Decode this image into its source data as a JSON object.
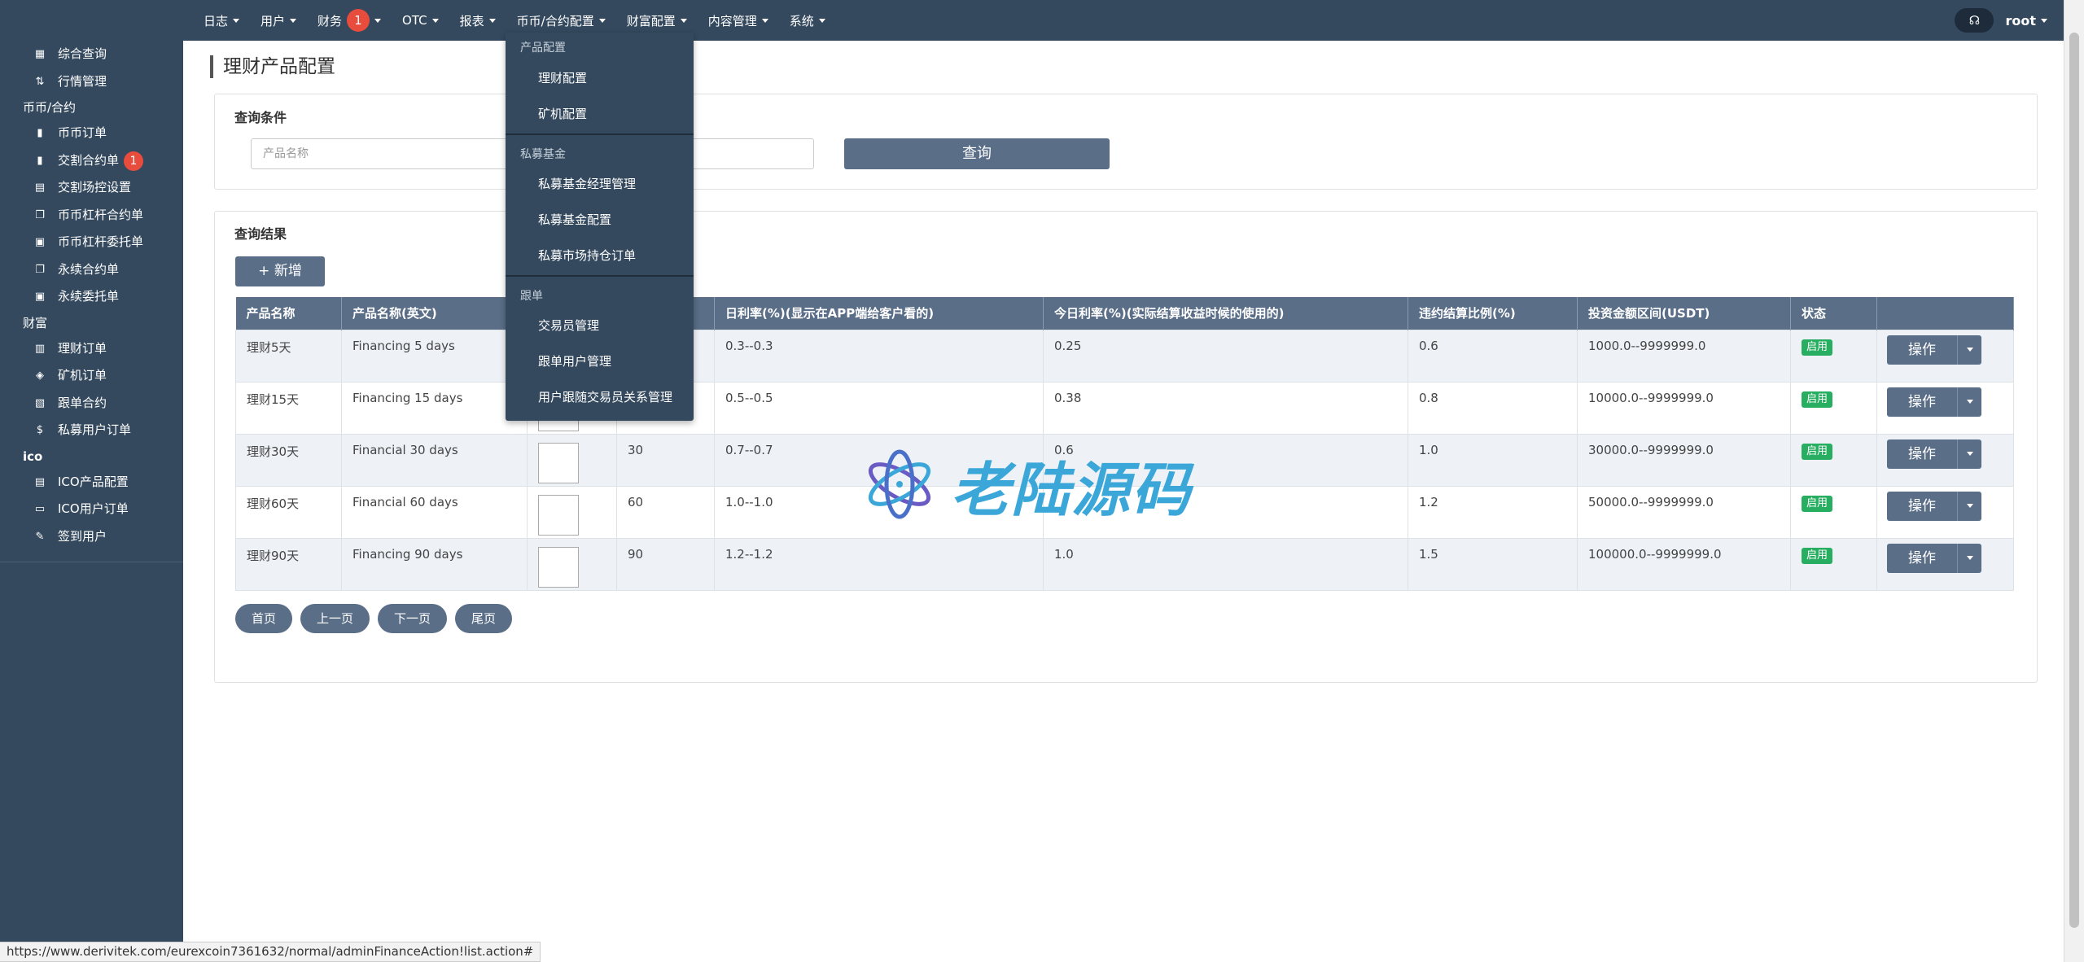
{
  "topnav": {
    "items": [
      {
        "label": "日志"
      },
      {
        "label": "用户"
      },
      {
        "label": "财务",
        "badge": "1"
      },
      {
        "label": "OTC"
      },
      {
        "label": "报表"
      },
      {
        "label": "币币/合约配置"
      },
      {
        "label": "财富配置"
      },
      {
        "label": "内容管理"
      },
      {
        "label": "系统"
      }
    ],
    "user": "root"
  },
  "sidebar": {
    "sections": [
      {
        "header": "",
        "items": [
          {
            "label": "综合查询",
            "icon": "dashboard-icon"
          },
          {
            "label": "行情管理",
            "icon": "sort-icon"
          }
        ]
      },
      {
        "header": "币币/合约",
        "items": [
          {
            "label": "币币订单",
            "icon": "bookmark-icon"
          },
          {
            "label": "交割合约单",
            "icon": "bookmark-icon",
            "badge": "1"
          },
          {
            "label": "交割场控设置",
            "icon": "clipboard-icon"
          },
          {
            "label": "币币杠杆合约单",
            "icon": "copy-icon"
          },
          {
            "label": "币币杠杆委托单",
            "icon": "file-clock-icon"
          },
          {
            "label": "永续合约单",
            "icon": "copy-icon"
          },
          {
            "label": "永续委托单",
            "icon": "file-clock-icon"
          }
        ]
      },
      {
        "header": "财富",
        "items": [
          {
            "label": "理财订单",
            "icon": "wallet-icon"
          },
          {
            "label": "矿机订单",
            "icon": "layers-icon"
          },
          {
            "label": "跟单合约",
            "icon": "file-user-icon"
          },
          {
            "label": "私募用户订单",
            "icon": "dollar-icon"
          }
        ]
      },
      {
        "header": "ico",
        "items": [
          {
            "label": "ICO产品配置",
            "icon": "file-list-icon"
          },
          {
            "label": "ICO用户订单",
            "icon": "screen-icon"
          },
          {
            "label": "签到用户",
            "icon": "edit-icon"
          }
        ]
      }
    ]
  },
  "page": {
    "title": "理财产品配置"
  },
  "query": {
    "title": "查询条件",
    "placeholder": "产品名称",
    "button": "查询"
  },
  "results": {
    "title": "查询结果",
    "add_button": "+ 新增",
    "columns": [
      "产品名称",
      "产品名称(英文)",
      "",
      "",
      "日利率(%)(显示在APP端给客户看的)",
      "今日利率(%)(实际结算收益时候的使用的)",
      "违约结算比例(%)",
      "投资金额区间(USDT)",
      "状态",
      ""
    ],
    "rows": [
      {
        "name": "理财5天",
        "name_en": "Financing 5 days",
        "days": "",
        "rate": "0.3--0.3",
        "today_rate": "0.25",
        "penalty": "0.6",
        "range": "1000.0--9999999.0",
        "status": "启用",
        "op": "操作"
      },
      {
        "name": "理财15天",
        "name_en": "Financing 15 days",
        "days": "",
        "rate": "0.5--0.5",
        "today_rate": "0.38",
        "penalty": "0.8",
        "range": "10000.0--9999999.0",
        "status": "启用",
        "op": "操作"
      },
      {
        "name": "理财30天",
        "name_en": "Financial 30 days",
        "days": "30",
        "rate": "0.7--0.7",
        "today_rate": "0.6",
        "penalty": "1.0",
        "range": "30000.0--9999999.0",
        "status": "启用",
        "op": "操作"
      },
      {
        "name": "理财60天",
        "name_en": "Financial 60 days",
        "days": "60",
        "rate": "1.0--1.0",
        "today_rate": "",
        "penalty": "1.2",
        "range": "50000.0--9999999.0",
        "status": "启用",
        "op": "操作"
      },
      {
        "name": "理财90天",
        "name_en": "Financing 90 days",
        "days": "90",
        "rate": "1.2--1.2",
        "today_rate": "1.0",
        "penalty": "1.5",
        "range": "100000.0--9999999.0",
        "status": "启用",
        "op": "操作"
      }
    ]
  },
  "pager": {
    "first": "首页",
    "prev": "上一页",
    "next": "下一页",
    "last": "尾页"
  },
  "dropdown": {
    "groups": [
      {
        "header": "产品配置",
        "items": [
          "理财配置",
          "矿机配置"
        ]
      },
      {
        "header": "私募基金",
        "items": [
          "私募基金经理管理",
          "私募基金配置",
          "私募市场持仓订单"
        ]
      },
      {
        "header": "跟单",
        "items": [
          "交易员管理",
          "跟单用户管理",
          "用户跟随交易员关系管理"
        ]
      }
    ]
  },
  "watermark": "老陆源码",
  "statusbar": "https://www.derivitek.com/eurexcoin7361632/normal/adminFinanceAction!list.action#",
  "colors": {
    "sidebar": "#34495e",
    "accent": "#5a6e88",
    "status_green": "#27ae60",
    "badge_red": "#e74c3c"
  }
}
